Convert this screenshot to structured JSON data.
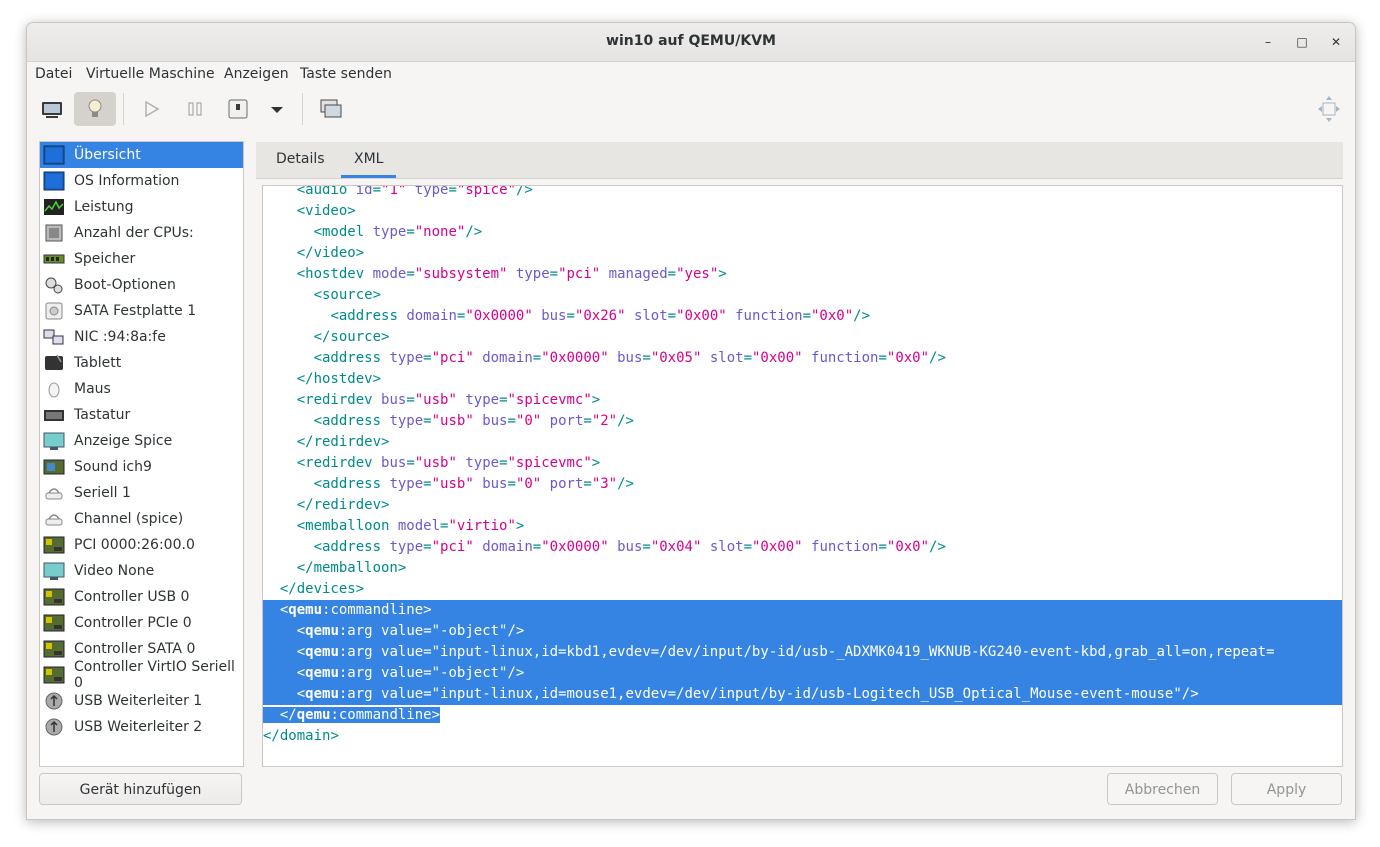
{
  "window": {
    "title": "win10 auf QEMU/KVM",
    "minimize": "–",
    "maximize": "□",
    "close": "✕"
  },
  "menubar": [
    "Datei",
    "Virtuelle Maschine",
    "Anzeigen",
    "Taste senden"
  ],
  "toolbar": {
    "icons": [
      "monitor-icon",
      "bulb-icon",
      "play-icon",
      "pause-icon",
      "power-icon",
      "dropdown-arrow-icon",
      "snapshot-icon",
      "fullscreen-move-icon"
    ],
    "active": "bulb-icon"
  },
  "sidebar": {
    "selected_index": 0,
    "items": [
      {
        "label": "Übersicht",
        "icon": "monitor-blue-icon"
      },
      {
        "label": "OS Information",
        "icon": "monitor-blue-icon"
      },
      {
        "label": "Leistung",
        "icon": "performance-chart-icon"
      },
      {
        "label": "Anzahl der CPUs:",
        "icon": "cpu-chip-icon"
      },
      {
        "label": "Speicher",
        "icon": "memory-stick-icon"
      },
      {
        "label": "Boot-Optionen",
        "icon": "gears-icon"
      },
      {
        "label": "SATA Festplatte 1",
        "icon": "harddisk-icon"
      },
      {
        "label": "NIC :94:8a:fe",
        "icon": "network-icon"
      },
      {
        "label": "Tablett",
        "icon": "tablet-icon"
      },
      {
        "label": "Maus",
        "icon": "mouse-icon"
      },
      {
        "label": "Tastatur",
        "icon": "keyboard-icon"
      },
      {
        "label": "Anzeige Spice",
        "icon": "display-icon"
      },
      {
        "label": "Sound ich9",
        "icon": "sound-card-icon"
      },
      {
        "label": "Seriell 1",
        "icon": "serial-icon"
      },
      {
        "label": "Channel (spice)",
        "icon": "serial-icon"
      },
      {
        "label": "PCI 0000:26:00.0",
        "icon": "pci-card-icon"
      },
      {
        "label": "Video None",
        "icon": "display-icon"
      },
      {
        "label": "Controller USB 0",
        "icon": "pci-card-icon"
      },
      {
        "label": "Controller PCIe 0",
        "icon": "pci-card-icon"
      },
      {
        "label": "Controller SATA 0",
        "icon": "pci-card-icon"
      },
      {
        "label": "Controller VirtIO Seriell 0",
        "icon": "pci-card-icon"
      },
      {
        "label": "USB Weiterleiter 1",
        "icon": "usb-icon"
      },
      {
        "label": "USB Weiterleiter 2",
        "icon": "usb-icon"
      }
    ],
    "add_button": "Gerät hinzufügen"
  },
  "tabs": {
    "items": [
      "Details",
      "XML"
    ],
    "active": "XML"
  },
  "editor": {
    "lines": [
      "    <audio id=\"1\" type=\"spice\"/>",
      "    <video>",
      "      <model type=\"none\"/>",
      "    </video>",
      "    <hostdev mode=\"subsystem\" type=\"pci\" managed=\"yes\">",
      "      <source>",
      "        <address domain=\"0x0000\" bus=\"0x26\" slot=\"0x00\" function=\"0x0\"/>",
      "      </source>",
      "      <address type=\"pci\" domain=\"0x0000\" bus=\"0x05\" slot=\"0x00\" function=\"0x0\"/>",
      "    </hostdev>",
      "    <redirdev bus=\"usb\" type=\"spicevmc\">",
      "      <address type=\"usb\" bus=\"0\" port=\"2\"/>",
      "    </redirdev>",
      "    <redirdev bus=\"usb\" type=\"spicevmc\">",
      "      <address type=\"usb\" bus=\"0\" port=\"3\"/>",
      "    </redirdev>",
      "    <memballoon model=\"virtio\">",
      "      <address type=\"pci\" domain=\"0x0000\" bus=\"0x04\" slot=\"0x00\" function=\"0x0\"/>",
      "    </memballoon>",
      "  </devices>",
      "  <qemu:commandline>",
      "    <qemu:arg value=\"-object\"/>",
      "    <qemu:arg value=\"input-linux,id=kbd1,evdev=/dev/input/by-id/usb-_ADXMK0419_WKNUB-KG240-event-kbd,grab_all=on,repeat=",
      "    <qemu:arg value=\"-object\"/>",
      "    <qemu:arg value=\"input-linux,id=mouse1,evdev=/dev/input/by-id/usb-Logitech_USB_Optical_Mouse-event-mouse\"/>",
      "  </qemu:commandline>",
      "</domain>"
    ],
    "selected_first_line": 20,
    "selected_last_line": 25
  },
  "buttons": {
    "cancel": "Abbrechen",
    "apply": "Apply"
  },
  "colors": {
    "accent": "#3584e4",
    "tag": "#008b8b",
    "attr": "#6a5acd",
    "value": "#d6008f"
  }
}
